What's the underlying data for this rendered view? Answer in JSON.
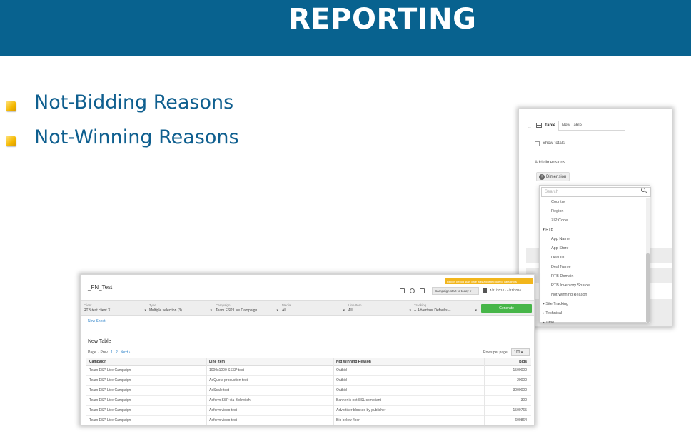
{
  "header": {
    "title": "REPORTING"
  },
  "bullets": [
    {
      "text": "Not-Bidding Reasons"
    },
    {
      "text": "Not-Winning Reasons"
    }
  ],
  "dimension_panel": {
    "table_label": "Table",
    "table_name": "New Table",
    "show_totals": "Show totals",
    "add_dimensions": "Add dimensions",
    "dimension_button": "Dimension",
    "search_placeholder": "Search",
    "items": [
      "Country",
      "Region",
      "ZIP Code"
    ],
    "rtb_group": "RTB",
    "rtb_items": [
      "App Name",
      "App Store",
      "Deal ID",
      "Deal Name",
      "RTB Domain",
      "RTB Inventory Source",
      "Not Winning Reason"
    ],
    "groups": [
      "Site Tracking",
      "Technical",
      "Time"
    ]
  },
  "report": {
    "title": "_FN_Test",
    "warning": "Report period start date was adjusted due to data limits",
    "campaign_range": "Campaign start to today",
    "date_range": "4/21/2014 - 4/21/2016",
    "filters": [
      {
        "label": "Client",
        "value": "RTB-test client X"
      },
      {
        "label": "Type",
        "value": "Multiple selection (3)"
      },
      {
        "label": "Campaign",
        "value": "Team ESP Live Campaign"
      },
      {
        "label": "Media",
        "value": "All"
      },
      {
        "label": "Line Item",
        "value": "All"
      },
      {
        "label": "Tracking",
        "value": "-- Advertiser Defaults --"
      }
    ],
    "generate": "Generate",
    "tab": "New Sheet",
    "table_title": "New Table",
    "pager": {
      "label": "Page",
      "prev": "Prev",
      "p1": "1",
      "p2": "2",
      "next": "Next"
    },
    "rows_per_page_label": "Rows per page",
    "rows_per_page": "100",
    "columns": [
      "Campaign",
      "Line Item",
      "Not Winning Reason",
      "Bids"
    ],
    "rows": [
      [
        "Team ESP Live Campaign",
        "1000x1000 SSSP test",
        "Outbid",
        "1500000"
      ],
      [
        "Team ESP Live Campaign",
        "AdQuota production test",
        "Outbid",
        "20000"
      ],
      [
        "Team ESP Live Campaign",
        "AdScale test",
        "Outbid",
        "3000000"
      ],
      [
        "Team ESP Live Campaign",
        "Adform SSP via Bidswitch",
        "Banner is not SSL compliant",
        "300"
      ],
      [
        "Team ESP Live Campaign",
        "Adform video test",
        "Advertiser blocked by publisher",
        "1500765"
      ],
      [
        "Team ESP Live Campaign",
        "Adform video test",
        "Bid below floor",
        "600864"
      ]
    ]
  },
  "colors": {
    "header_bg": "#08628f",
    "bullet_text": "#0f5f8f",
    "bullet_mark": "#f4b800",
    "generate_btn": "#47b649",
    "warning": "#f2b61c",
    "link": "#2c82c9"
  }
}
